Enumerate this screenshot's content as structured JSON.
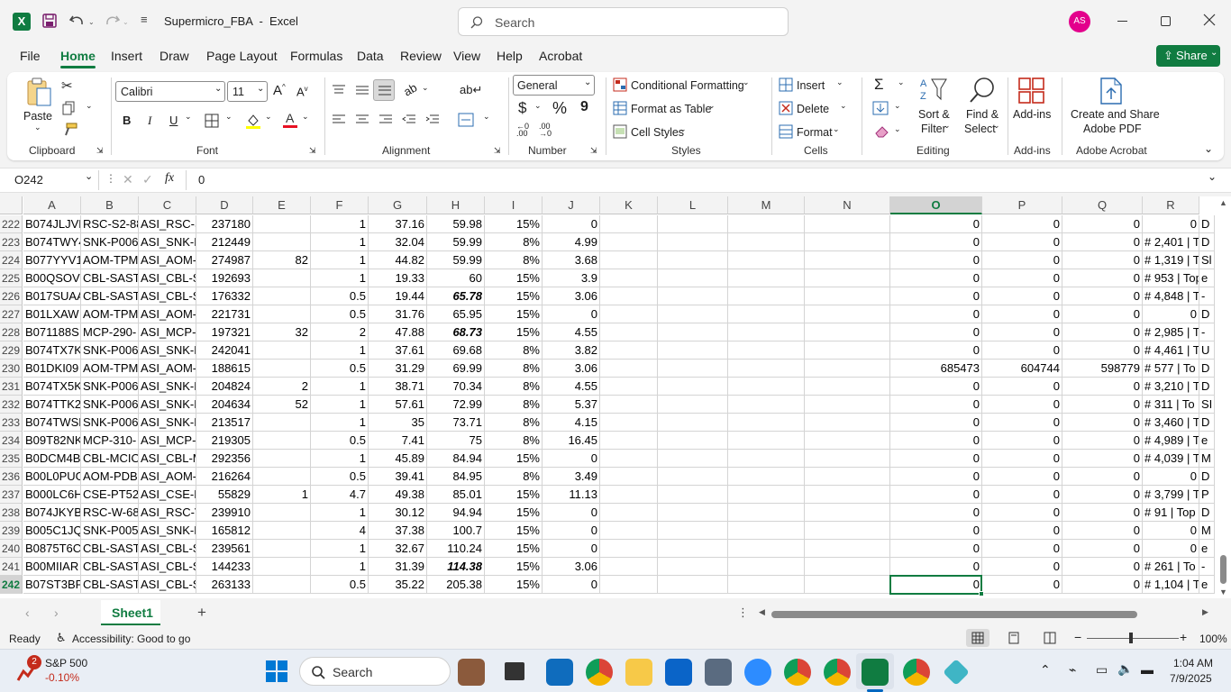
{
  "titlebar": {
    "app_letter": "X",
    "title": "Supermicro_FBA  -  Excel",
    "search_placeholder": "Search",
    "user_initials": "AS",
    "accent": "#107c41",
    "avatar_color": "#e3008c"
  },
  "tabs": [
    "File",
    "Home",
    "Insert",
    "Draw",
    "Page Layout",
    "Formulas",
    "Data",
    "Review",
    "View",
    "Help",
    "Acrobat"
  ],
  "active_tab": "Home",
  "share_label": "Share",
  "ribbon": {
    "clipboard": {
      "paste": "Paste",
      "label": "Clipboard"
    },
    "font": {
      "name": "Calibri",
      "size": "11",
      "label": "Font",
      "bold": "B",
      "italic": "I",
      "underline": "U"
    },
    "alignment": {
      "label": "Alignment"
    },
    "number": {
      "format": "General",
      "label": "Number",
      "currency": "$",
      "percent": "%",
      "comma": "9"
    },
    "styles": {
      "conditional": "Conditional Formatting",
      "format_table": "Format as Table",
      "cell_styles": "Cell Styles",
      "label": "Styles"
    },
    "cells": {
      "insert": "Insert",
      "delete": "Delete",
      "format": "Format",
      "label": "Cells"
    },
    "editing": {
      "sort_filter_1": "Sort &",
      "sort_filter_2": "Filter",
      "find_select_1": "Find &",
      "find_select_2": "Select",
      "label": "Editing"
    },
    "addins": {
      "button": "Add-ins",
      "label": "Add-ins"
    },
    "acrobat": {
      "line1": "Create and Share",
      "line2": "Adobe PDF",
      "label": "Adobe Acrobat"
    }
  },
  "formula_bar": {
    "name_box": "O242",
    "fx": "fx",
    "value": "0"
  },
  "columns": [
    "A",
    "B",
    "C",
    "D",
    "E",
    "F",
    "G",
    "H",
    "I",
    "J",
    "K",
    "L",
    "M",
    "N",
    "O",
    "P",
    "Q",
    "R"
  ],
  "selected_column": "O",
  "selected_row": "242",
  "rows": [
    {
      "n": "222",
      "A": "B074JLJVN",
      "B": "RSC-S2-88",
      "C": "ASI_RSC-S",
      "D": "237180",
      "E": "",
      "F": "1",
      "G": "37.16",
      "H": "59.98",
      "I": "15%",
      "J": "0",
      "O": "0",
      "P": "0",
      "Q": "0",
      "R": "0",
      "S": "D"
    },
    {
      "n": "223",
      "A": "B074TWY4",
      "B": "SNK-P006",
      "C": "ASI_SNK-P",
      "D": "212449",
      "E": "",
      "F": "1",
      "G": "32.04",
      "H": "59.99",
      "I": "8%",
      "J": "4.99",
      "O": "0",
      "P": "0",
      "Q": "0",
      "R": "# 2,401 | T",
      "S": "D"
    },
    {
      "n": "224",
      "A": "B077YYV1",
      "B": "AOM-TPM",
      "C": "ASI_AOM-",
      "D": "274987",
      "E": "82",
      "F": "1",
      "G": "44.82",
      "H": "59.99",
      "I": "8%",
      "J": "3.68",
      "O": "0",
      "P": "0",
      "Q": "0",
      "R": "# 1,319 | T",
      "S": "Sl"
    },
    {
      "n": "225",
      "A": "B00QSOV",
      "B": "CBL-SAST-",
      "C": "ASI_CBL-S",
      "D": "192693",
      "E": "",
      "F": "1",
      "G": "19.33",
      "H": "60",
      "I": "15%",
      "J": "3.9",
      "O": "0",
      "P": "0",
      "Q": "0",
      "R": "# 953 | Top",
      "S": "e"
    },
    {
      "n": "226",
      "A": "B017SUAA",
      "B": "CBL-SAST-",
      "C": "ASI_CBL-S",
      "D": "176332",
      "E": "",
      "F": "0.5",
      "G": "19.44",
      "H": "65.78",
      "I": "15%",
      "J": "3.06",
      "O": "0",
      "P": "0",
      "Q": "0",
      "R": "# 4,848 | T",
      "S": "-"
    },
    {
      "n": "227",
      "A": "B01LXAW",
      "B": "AOM-TPM",
      "C": "ASI_AOM-",
      "D": "221731",
      "E": "",
      "F": "0.5",
      "G": "31.76",
      "H": "65.95",
      "I": "15%",
      "J": "0",
      "O": "0",
      "P": "0",
      "Q": "0",
      "R": "0",
      "S": "D"
    },
    {
      "n": "228",
      "A": "B071188S",
      "B": "MCP-290-",
      "C": "ASI_MCP-",
      "D": "197321",
      "E": "32",
      "F": "2",
      "G": "47.88",
      "H": "68.73",
      "I": "15%",
      "J": "4.55",
      "O": "0",
      "P": "0",
      "Q": "0",
      "R": "# 2,985 | T",
      "S": "-"
    },
    {
      "n": "229",
      "A": "B074TX7K",
      "B": "SNK-P006",
      "C": "ASI_SNK-P",
      "D": "242041",
      "E": "",
      "F": "1",
      "G": "37.61",
      "H": "69.68",
      "I": "8%",
      "J": "3.82",
      "O": "0",
      "P": "0",
      "Q": "0",
      "R": "# 4,461 | T",
      "S": "U"
    },
    {
      "n": "230",
      "A": "B01DKI09",
      "B": "AOM-TPM",
      "C": "ASI_AOM-",
      "D": "188615",
      "E": "",
      "F": "0.5",
      "G": "31.29",
      "H": "69.99",
      "I": "8%",
      "J": "3.06",
      "O": "685473",
      "P": "604744",
      "Q": "598779",
      "R": "# 577 | To",
      "S": "D"
    },
    {
      "n": "231",
      "A": "B074TX5K",
      "B": "SNK-P006",
      "C": "ASI_SNK-P",
      "D": "204824",
      "E": "2",
      "F": "1",
      "G": "38.71",
      "H": "70.34",
      "I": "8%",
      "J": "4.55",
      "O": "0",
      "P": "0",
      "Q": "0",
      "R": "# 3,210 | T",
      "S": "D"
    },
    {
      "n": "232",
      "A": "B074TTK2",
      "B": "SNK-P006",
      "C": "ASI_SNK-P",
      "D": "204634",
      "E": "52",
      "F": "1",
      "G": "57.61",
      "H": "72.99",
      "I": "8%",
      "J": "5.37",
      "O": "0",
      "P": "0",
      "Q": "0",
      "R": "# 311 | To",
      "S": "SI"
    },
    {
      "n": "233",
      "A": "B074TWSL",
      "B": "SNK-P006",
      "C": "ASI_SNK-P",
      "D": "213517",
      "E": "",
      "F": "1",
      "G": "35",
      "H": "73.71",
      "I": "8%",
      "J": "4.15",
      "O": "0",
      "P": "0",
      "Q": "0",
      "R": "# 3,460 | T",
      "S": "D"
    },
    {
      "n": "234",
      "A": "B09T82NK",
      "B": "MCP-310-",
      "C": "ASI_MCP-",
      "D": "219305",
      "E": "",
      "F": "0.5",
      "G": "7.41",
      "H": "75",
      "I": "8%",
      "J": "16.45",
      "O": "0",
      "P": "0",
      "Q": "0",
      "R": "# 4,989 | T",
      "S": "e"
    },
    {
      "n": "235",
      "A": "B0DCM4B",
      "B": "CBL-MCIO",
      "C": "ASI_CBL-M",
      "D": "292356",
      "E": "",
      "F": "1",
      "G": "45.89",
      "H": "84.94",
      "I": "15%",
      "J": "0",
      "O": "0",
      "P": "0",
      "Q": "0",
      "R": "# 4,039 | T",
      "S": "M"
    },
    {
      "n": "236",
      "A": "B00L0PUG",
      "B": "AOM-PDB",
      "C": "ASI_AOM-",
      "D": "216264",
      "E": "",
      "F": "0.5",
      "G": "39.41",
      "H": "84.95",
      "I": "8%",
      "J": "3.49",
      "O": "0",
      "P": "0",
      "Q": "0",
      "R": "0",
      "S": "D"
    },
    {
      "n": "237",
      "A": "B000LC6H",
      "B": "CSE-PT52L",
      "C": "ASI_CSE-P",
      "D": "55829",
      "E": "1",
      "F": "4.7",
      "G": "49.38",
      "H": "85.01",
      "I": "15%",
      "J": "11.13",
      "O": "0",
      "P": "0",
      "Q": "0",
      "R": "# 3,799 | T",
      "S": "P"
    },
    {
      "n": "238",
      "A": "B074JKYBJ",
      "B": "RSC-W-68",
      "C": "ASI_RSC-V",
      "D": "239910",
      "E": "",
      "F": "1",
      "G": "30.12",
      "H": "94.94",
      "I": "15%",
      "J": "0",
      "O": "0",
      "P": "0",
      "Q": "0",
      "R": "# 91 | Top",
      "S": "D"
    },
    {
      "n": "239",
      "A": "B005C1JQ",
      "B": "SNK-P005",
      "C": "ASI_SNK-P",
      "D": "165812",
      "E": "",
      "F": "4",
      "G": "37.38",
      "H": "100.7",
      "I": "15%",
      "J": "0",
      "O": "0",
      "P": "0",
      "Q": "0",
      "R": "0",
      "S": "M"
    },
    {
      "n": "240",
      "A": "B0875T6C",
      "B": "CBL-SAST-",
      "C": "ASI_CBL-S",
      "D": "239561",
      "E": "",
      "F": "1",
      "G": "32.67",
      "H": "110.24",
      "I": "15%",
      "J": "0",
      "O": "0",
      "P": "0",
      "Q": "0",
      "R": "0",
      "S": "e"
    },
    {
      "n": "241",
      "A": "B00MIIAR",
      "B": "CBL-SAST-",
      "C": "ASI_CBL-S",
      "D": "144233",
      "E": "",
      "F": "1",
      "G": "31.39",
      "H": "114.38",
      "I": "15%",
      "J": "3.06",
      "O": "0",
      "P": "0",
      "Q": "0",
      "R": "# 261 | To",
      "S": "-"
    },
    {
      "n": "242",
      "A": "B07ST3BF",
      "B": "CBL-SAST-",
      "C": "ASI_CBL-S",
      "D": "263133",
      "E": "",
      "F": "0.5",
      "G": "35.22",
      "H": "205.38",
      "I": "15%",
      "J": "0",
      "O": "0",
      "P": "0",
      "Q": "0",
      "R": "# 1,104 | T",
      "S": "e"
    }
  ],
  "bold_italic_cells": [
    "226-H",
    "228-H",
    "241-H"
  ],
  "sheet_tab": "Sheet1",
  "status": {
    "ready": "Ready",
    "accessibility": "Accessibility: Good to go",
    "zoom": "100%"
  },
  "taskbar": {
    "widget_badge": "2",
    "widget_name": "S&P 500",
    "widget_value": "-0.10%",
    "search": "Search",
    "time": "1:04 AM",
    "date": "7/9/2025",
    "widget_value_color": "#c42b1c"
  }
}
